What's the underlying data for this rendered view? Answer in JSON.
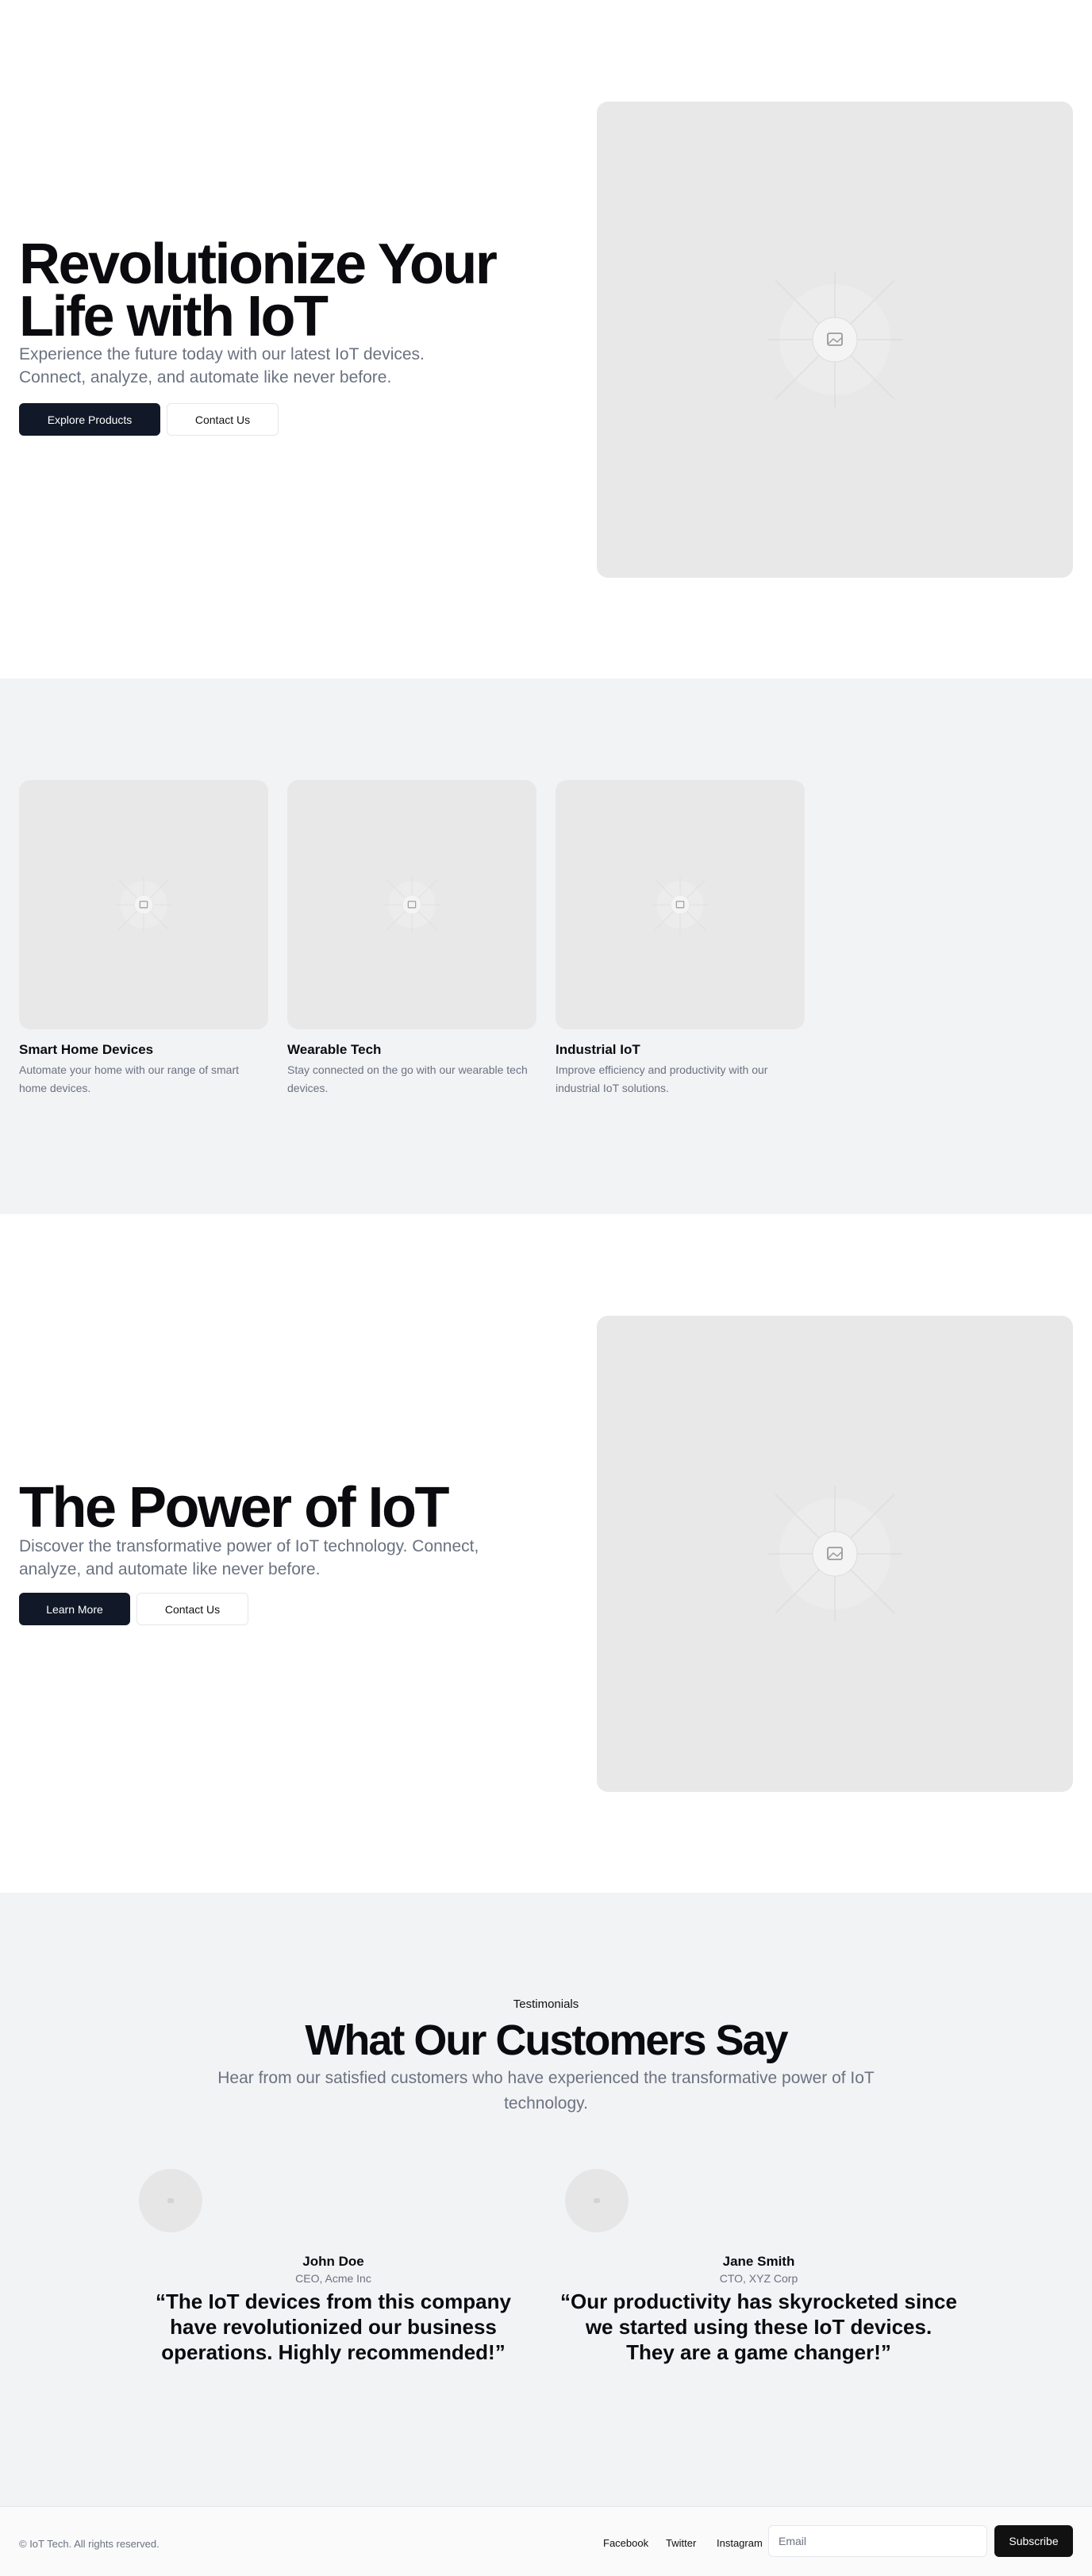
{
  "hero": {
    "title": "Revolutionize Your Life with IoT",
    "subtitle": "Experience the future today with our latest IoT devices. Connect, analyze, and automate like never before.",
    "primary_button": "Explore Products",
    "secondary_button": "Contact Us",
    "image_icon": "image-placeholder-icon"
  },
  "features": {
    "cards": [
      {
        "title": "Smart Home Devices",
        "description": "Automate your home with our range of smart home devices."
      },
      {
        "title": "Wearable Tech",
        "description": "Stay connected on the go with our wearable tech devices."
      },
      {
        "title": "Industrial IoT",
        "description": "Improve efficiency and productivity with our industrial IoT solutions."
      }
    ]
  },
  "power": {
    "title": "The Power of IoT",
    "subtitle": "Discover the transformative power of IoT technology. Connect, analyze, and automate like never before.",
    "primary_button": "Learn More",
    "secondary_button": "Contact Us"
  },
  "testimonials": {
    "eyebrow": "Testimonials",
    "title": "What Our Customers Say",
    "subtitle": "Hear from our satisfied customers who have experienced the transformative power of IoT technology.",
    "items": [
      {
        "name": "John Doe",
        "role": "CEO, Acme Inc",
        "quote": "“The IoT devices from this company have revolutionized our business operations. Highly recommended!”"
      },
      {
        "name": "Jane Smith",
        "role": "CTO, XYZ Corp",
        "quote": "“Our productivity has skyrocketed since we started using these IoT devices. They are a game changer!”"
      }
    ]
  },
  "footer": {
    "copyright": "© IoT Tech. All rights reserved.",
    "links": [
      "Facebook",
      "Twitter",
      "Instagram"
    ],
    "email_placeholder": "Email",
    "subscribe_label": "Subscribe"
  },
  "colors": {
    "primary_dark": "#111827",
    "muted_text": "#6b7280",
    "section_bg": "#f2f3f5",
    "placeholder_bg": "#e8e8e8"
  }
}
